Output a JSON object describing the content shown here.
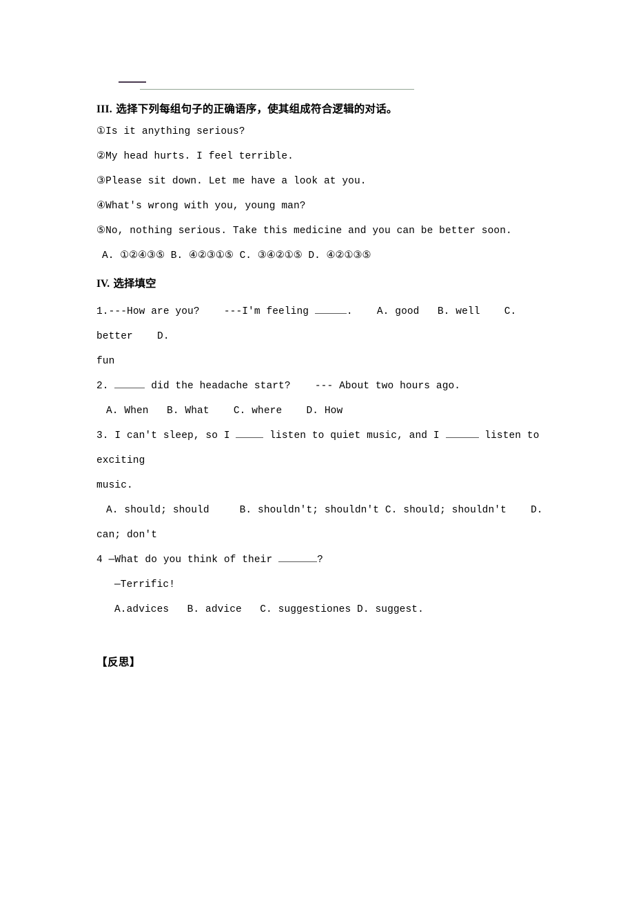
{
  "document": {
    "top_rule": {
      "dash_mark": "——",
      "rule_color": "#93a694",
      "dash_color": "#493a50"
    },
    "section_iii": {
      "roman": "III.",
      "title": "选择下列每组句子的正确语序，使其组成符合逻辑的对话。",
      "sentences": [
        "①Is it anything serious?",
        "②My head hurts. I feel terrible.",
        "③Please sit down. Let me have a look at you.",
        "④What's wrong with you, young man?",
        "⑤No, nothing serious. Take this medicine and you can be better soon."
      ],
      "answer_choices": "A. ①②④③⑤ B. ④②③①⑤ C. ③④②①⑤ D. ④②①③⑤"
    },
    "section_iv": {
      "roman": "IV.",
      "title": "选择填空",
      "questions": [
        {
          "number": "1.",
          "stem_part1": "---How are you?    ---I'm feeling ",
          "stem_part2": ".    A. good   B. well    C. better    D.",
          "continuation": "fun"
        },
        {
          "number": "2.",
          "stem_part1": " ",
          "stem_part2": " did the headache start?    --- About two hours ago.",
          "options": "A. When   B. What    C. where    D. How"
        },
        {
          "number": "3.",
          "stem_part1": " I can't sleep, so I ",
          "stem_part2": " listen to quiet music, and I ",
          "stem_part3": " listen to exciting",
          "continuation": "music.",
          "options_line1": "A. should; should     B. shouldn't; shouldn't C. should; shouldn't    D.",
          "options_line2": "can; don't"
        },
        {
          "number": "4",
          "stem_part1": " —What do you think of their ",
          "stem_part2": "?",
          "reply": "—Terrific!",
          "options": "A.advices   B. advice   C. suggestiones D. suggest."
        }
      ]
    },
    "reflection": {
      "title": "【反思】"
    }
  }
}
